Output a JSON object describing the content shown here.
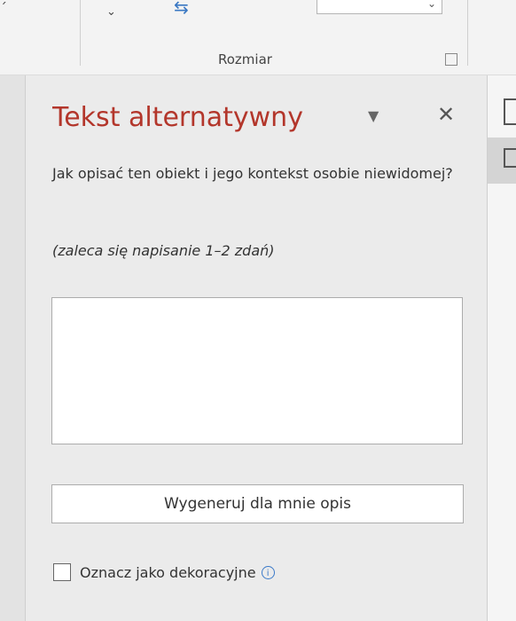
{
  "ribbon": {
    "group_caption": "Rozmiar"
  },
  "pane": {
    "title": "Tekst alternatywny",
    "prompt": "Jak opisać ten obiekt i jego kontekst osobie niewidomej?",
    "hint": "(zaleca się napisanie 1–2 zdań)",
    "description_value": "",
    "generate_button": "Wygeneruj dla mnie opis",
    "decorative_checkbox_label": "Oznacz jako dekoracyjne",
    "decorative_checked": false
  },
  "colors": {
    "title": "#b3362b",
    "info_icon": "#3b7ac9",
    "background": "#ebebeb"
  },
  "icons": [
    "chevron-down-icon",
    "swap-arrows-icon",
    "dialog-launcher-icon",
    "pane-options-icon",
    "close-icon",
    "info-icon"
  ]
}
